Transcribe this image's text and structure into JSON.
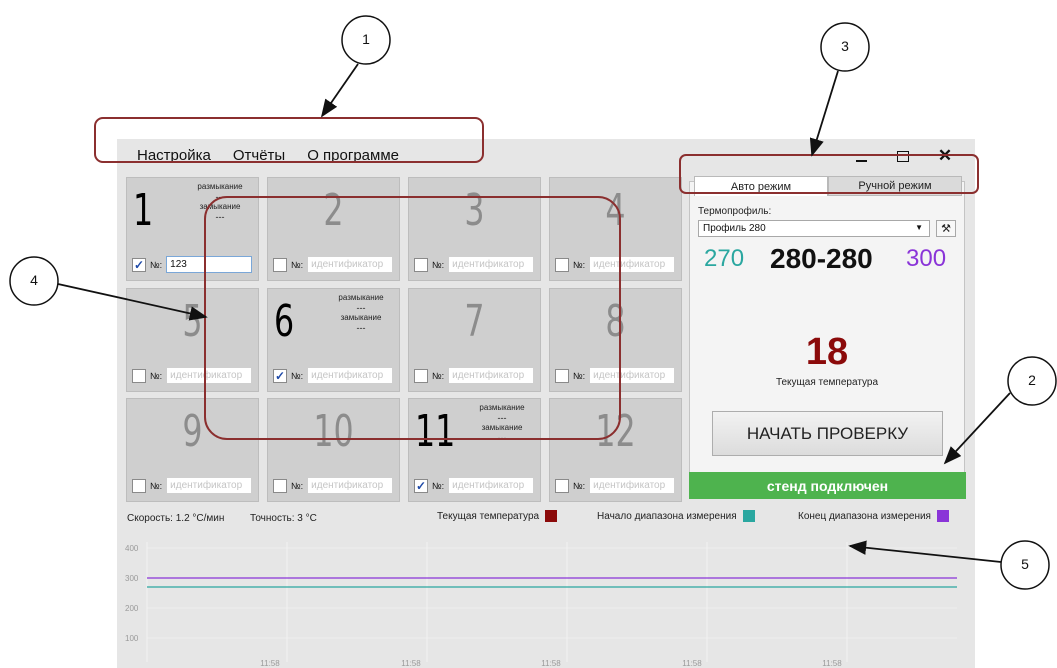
{
  "menu": [
    "Настройка",
    "Отчёты",
    "О программе"
  ],
  "window_controls": {
    "minimize_icon": "minimize-icon",
    "maximize_icon": "maximize-icon",
    "close_icon": "close-icon"
  },
  "tiles": [
    {
      "n": "1",
      "active": true,
      "checked": true,
      "open_label": "размыкание",
      "open_value": "---",
      "close_label": "замыкание",
      "close_value": "---",
      "nlabel": "№:",
      "id_value": "123"
    },
    {
      "n": "2",
      "active": false,
      "checked": false,
      "nlabel": "№:",
      "id_placeholder": "идентификатор"
    },
    {
      "n": "3",
      "active": false,
      "checked": false,
      "nlabel": "№:",
      "id_placeholder": "идентификатор"
    },
    {
      "n": "4",
      "active": false,
      "checked": false,
      "nlabel": "№:",
      "id_placeholder": "идентификатор"
    },
    {
      "n": "5",
      "active": false,
      "checked": false,
      "nlabel": "№:",
      "id_placeholder": "идентификатор"
    },
    {
      "n": "6",
      "active": true,
      "checked": true,
      "open_label": "размыкание",
      "open_value": "---",
      "close_label": "замыкание",
      "close_value": "---",
      "nlabel": "№:",
      "id_placeholder": "идентификатор"
    },
    {
      "n": "7",
      "active": false,
      "checked": false,
      "nlabel": "№:",
      "id_placeholder": "идентификатор"
    },
    {
      "n": "8",
      "active": false,
      "checked": false,
      "nlabel": "№:",
      "id_placeholder": "идентификатор"
    },
    {
      "n": "9",
      "active": false,
      "checked": false,
      "nlabel": "№:",
      "id_placeholder": "идентификатор"
    },
    {
      "n": "10",
      "active": false,
      "checked": false,
      "nlabel": "№:",
      "id_placeholder": "идентификатор"
    },
    {
      "n": "11",
      "active": true,
      "checked": true,
      "open_label": "размыкание",
      "open_value": "---",
      "close_label": "замыкание",
      "close_value": "---",
      "nlabel": "№:",
      "id_placeholder": "идентификатор"
    },
    {
      "n": "12",
      "active": false,
      "checked": false,
      "nlabel": "№:",
      "id_placeholder": "идентификатор"
    }
  ],
  "panel": {
    "tab_auto": "Авто режим",
    "tab_manual": "Ручной режим",
    "profile_label": "Термопрофиль:",
    "profile_value": "Профиль 280",
    "range_low": "270",
    "range_mid": "280-280",
    "range_high": "300",
    "current_temp": "18",
    "current_temp_label": "Текущая температура",
    "start_button": "НАЧАТЬ ПРОВЕРКУ",
    "status": "стенд подключен"
  },
  "info": {
    "speed": "Скорость: 1.2 °С/мин",
    "accuracy": "Точность: 3 °С",
    "legend_current": "Текущая температура",
    "legend_start": "Начало диапазона измерения",
    "legend_end": "Конец диапазона измерения"
  },
  "colors": {
    "current": "#8b0a0a",
    "start": "#2aa7a0",
    "end": "#8a34d8",
    "status_green": "#4eb34e"
  },
  "chart_data": {
    "type": "line",
    "x_ticks": [
      "11:58",
      "11:58",
      "11:58",
      "11:58",
      "11:58"
    ],
    "y_ticks": [
      400,
      300,
      200,
      100
    ],
    "ylim": [
      0,
      400
    ],
    "series": [
      {
        "name": "Начало диапазона измерения",
        "values": [
          270,
          270
        ]
      },
      {
        "name": "Конец диапазона измерения",
        "values": [
          300,
          300
        ]
      }
    ]
  },
  "annotations": [
    "1",
    "2",
    "3",
    "4",
    "5"
  ]
}
